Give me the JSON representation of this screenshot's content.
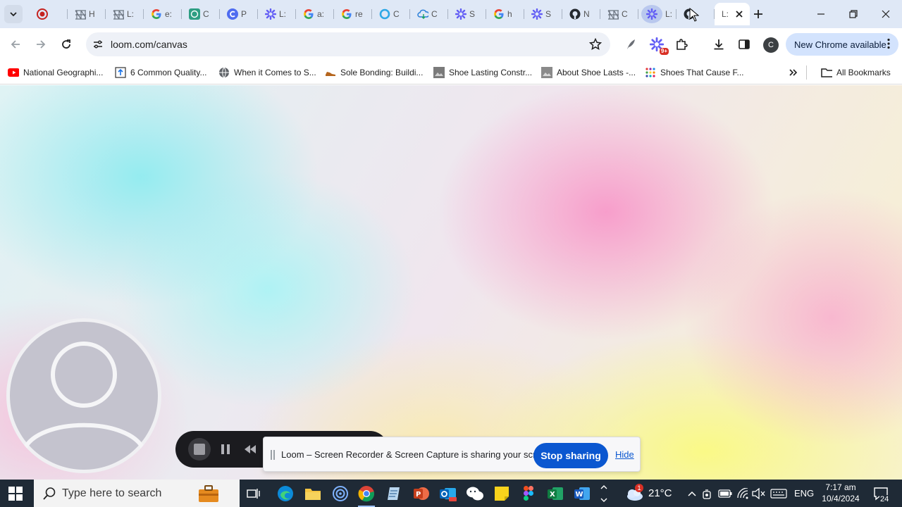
{
  "browser": {
    "tabs": [
      {
        "title": "",
        "icon": "record-red-icon"
      },
      {
        "title": "H",
        "icon": "web-grid-icon"
      },
      {
        "title": "L:",
        "icon": "web-grid-icon"
      },
      {
        "title": "e:",
        "icon": "google-icon"
      },
      {
        "title": "C",
        "icon": "chatgpt-icon"
      },
      {
        "title": "P",
        "icon": "c-circle-icon"
      },
      {
        "title": "L:",
        "icon": "loom-icon"
      },
      {
        "title": "a:",
        "icon": "google-icon"
      },
      {
        "title": "re",
        "icon": "google-icon"
      },
      {
        "title": "C",
        "icon": "ring-icon"
      },
      {
        "title": "C",
        "icon": "cloud-icon"
      },
      {
        "title": "S",
        "icon": "loom-icon"
      },
      {
        "title": "h",
        "icon": "google-icon"
      },
      {
        "title": "S",
        "icon": "loom-icon"
      },
      {
        "title": "N",
        "icon": "github-icon"
      },
      {
        "title": "C",
        "icon": "web-grid-icon"
      },
      {
        "title": "L:",
        "icon": "loom-icon"
      },
      {
        "title": "",
        "icon": "github-icon"
      },
      {
        "title": "L:",
        "icon": "loom-icon"
      }
    ],
    "url": "loom.com/canvas",
    "profile_initial": "C",
    "extension_badge": "9+",
    "update_label": "New Chrome available"
  },
  "bookmarks": [
    {
      "label": "National Geographi...",
      "icon": "youtube-icon"
    },
    {
      "label": "6 Common Quality...",
      "icon": "upload-box-icon"
    },
    {
      "label": "When it Comes to S...",
      "icon": "globe-icon"
    },
    {
      "label": "Sole Bonding: Buildi...",
      "icon": "shoe-icon"
    },
    {
      "label": "Shoe Lasting Constr...",
      "icon": "photo-icon"
    },
    {
      "label": "About Shoe Lasts -...",
      "icon": "photo-icon"
    },
    {
      "label": "Shoes That Cause F...",
      "icon": "dots-grid-icon"
    }
  ],
  "all_bookmarks_label": "All Bookmarks",
  "loom": {
    "share_message": "Loom – Screen Recorder & Screen Capture is sharing your screen.",
    "stop_sharing_label": "Stop sharing",
    "hide_label": "Hide"
  },
  "taskbar": {
    "search_placeholder": "Type here to search",
    "weather_temp": "21°C",
    "weather_badge": "1",
    "language": "ENG",
    "time": "7:17 am",
    "date": "10/4/2024",
    "notifications": "24"
  },
  "colors": {
    "tabstrip": "#dfe8f6",
    "accent_blue": "#0b57d0",
    "update_pill": "#d3e3fd",
    "taskbar": "#1f2a36"
  }
}
